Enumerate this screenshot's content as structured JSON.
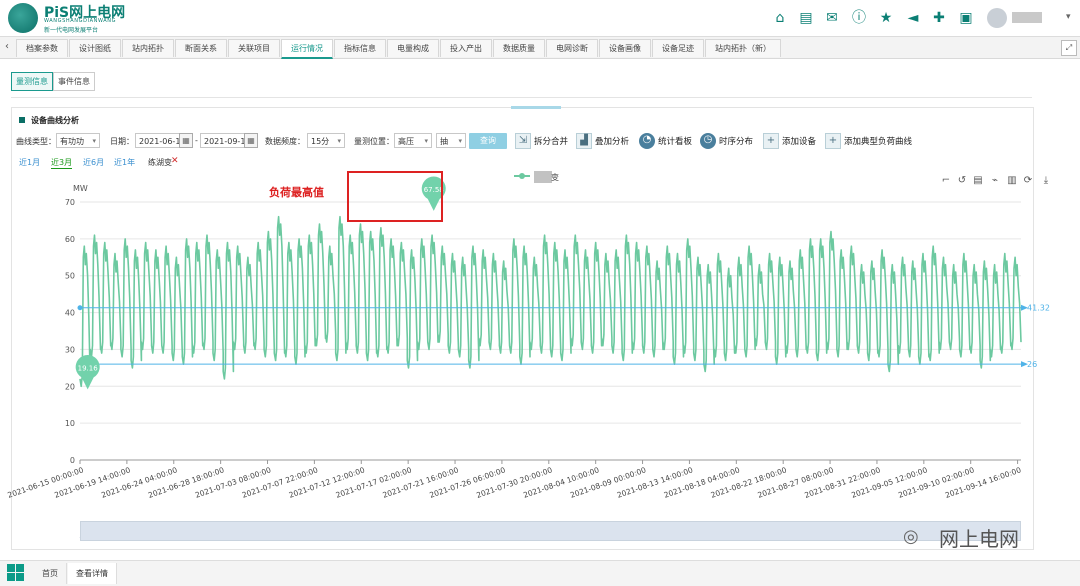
{
  "header": {
    "logo_main": "PiS网上电网",
    "logo_sub1": "WANGSHANGDIANWANG",
    "logo_sub2": "新一代电网发展平台",
    "icons": [
      "substation-icon",
      "document-icon",
      "chat-icon",
      "info-icon",
      "star-icon",
      "speaker-icon",
      "puzzle-icon",
      "report-icon"
    ]
  },
  "tabs": [
    "档案参数",
    "设计图纸",
    "站内拓扑",
    "断面关系",
    "关联项目",
    "运行情况",
    "指标信息",
    "电量构成",
    "投入产出",
    "数据质量",
    "电网诊断",
    "设备画像",
    "设备足迹",
    "站内拓扑（新）"
  ],
  "active_tab": "运行情况",
  "subtabs": [
    "量测信息",
    "事件信息"
  ],
  "active_subtab": "量测信息",
  "section_title": "设备曲线分析",
  "filters": {
    "curve_type_label": "曲线类型：",
    "curve_type_value": "有功功",
    "date_label": "日期：",
    "date_start": "2021-06-1",
    "date_sep": "-",
    "date_end": "2021-09-1",
    "freq_label": "数据频度：",
    "freq_value": "15分",
    "position_label": "量测位置：",
    "position_value": "高压",
    "position_value2": "抽",
    "query_button": "查询"
  },
  "toolbar": [
    "拆分合并",
    "叠加分析",
    "统计看板",
    "时序分布",
    "添加设备",
    "添加典型负荷曲线"
  ],
  "periods": [
    "近1月",
    "近3月",
    "近6月",
    "近1年"
  ],
  "active_period": "近3月",
  "substation_name": "练湖变",
  "legend_suffix": "变",
  "annotation_text": "负荷最高值",
  "watermark_text": "网上电网",
  "footer_tabs": [
    "首页",
    "查看详情"
  ],
  "chart_data": {
    "type": "line",
    "ylabel": "MW",
    "ylim": [
      0,
      70
    ],
    "yticks": [
      0,
      10,
      20,
      30,
      40,
      50,
      60,
      70
    ],
    "xlim": [
      "2021-06-15 00:00:00",
      "2021-09-15 00:00:00"
    ],
    "x_tick_labels": [
      "2021-06-15 00:00:00",
      "2021-06-19 14:00:00",
      "2021-06-24 04:00:00",
      "2021-06-28 18:00:00",
      "2021-07-03 08:00:00",
      "2021-07-07 22:00:00",
      "2021-07-12 12:00:00",
      "2021-07-17 02:00:00",
      "2021-07-21 16:00:00",
      "2021-07-26 06:00:00",
      "2021-07-30 20:00:00",
      "2021-08-04 10:00:00",
      "2021-08-09 00:00:00",
      "2021-08-13 14:00:00",
      "2021-08-18 04:00:00",
      "2021-08-22 18:00:00",
      "2021-08-27 08:00:00",
      "2021-08-31 22:00:00",
      "2021-09-05 12:00:00",
      "2021-09-10 02:00:00",
      "2021-09-14 16:00:00"
    ],
    "series": [
      {
        "color": "#6cc9a0",
        "daily_peak": [
          58,
          61,
          59,
          56,
          60,
          57,
          59,
          57,
          58,
          55,
          60,
          59,
          61,
          57,
          59,
          58,
          55,
          59,
          62,
          66,
          59,
          60,
          61,
          64,
          58,
          66,
          61,
          64,
          62,
          63,
          60,
          59,
          57,
          60,
          61,
          58,
          56,
          55,
          58,
          57,
          56,
          54,
          60,
          58,
          55,
          61,
          59,
          57,
          61,
          57,
          59,
          56,
          57,
          61,
          59,
          58,
          54,
          58,
          56,
          60,
          55,
          53,
          56,
          52,
          55,
          58,
          53,
          56,
          55,
          54,
          57,
          60,
          60,
          62,
          57,
          58,
          53,
          54,
          57,
          53,
          55,
          54,
          56,
          58,
          55,
          53,
          56,
          53,
          54,
          53,
          56,
          55
        ],
        "daily_min": [
          20,
          28,
          29,
          30,
          28,
          25,
          30,
          29,
          29,
          27,
          26,
          29,
          30,
          27,
          22,
          30,
          29,
          30,
          28,
          27,
          28,
          26,
          29,
          31,
          32,
          27,
          30,
          29,
          27,
          28,
          29,
          31,
          25,
          30,
          30,
          32,
          29,
          28,
          25,
          31,
          30,
          29,
          29,
          26,
          30,
          29,
          28,
          27,
          31,
          30,
          29,
          31,
          29,
          27,
          30,
          29,
          28,
          30,
          26,
          29,
          27,
          24,
          28,
          27,
          29,
          28,
          31,
          30,
          26,
          29,
          28,
          29,
          27,
          30,
          28,
          30,
          29,
          27,
          28,
          24,
          29,
          28,
          26,
          27,
          30,
          30,
          28,
          29,
          25,
          28,
          29,
          30
        ]
      }
    ],
    "max_marker": {
      "label": "67.58",
      "value": 67.58,
      "x": "2021-07-19 14:00:00"
    },
    "min_marker": {
      "label": "19.16",
      "value": 19.16,
      "x": "2021-06-15 18:00:00"
    },
    "mark_lines": [
      {
        "value": 41.32,
        "label": "41.32"
      },
      {
        "value": 26,
        "label": "26"
      }
    ],
    "grid": true,
    "legend": "top-center"
  }
}
